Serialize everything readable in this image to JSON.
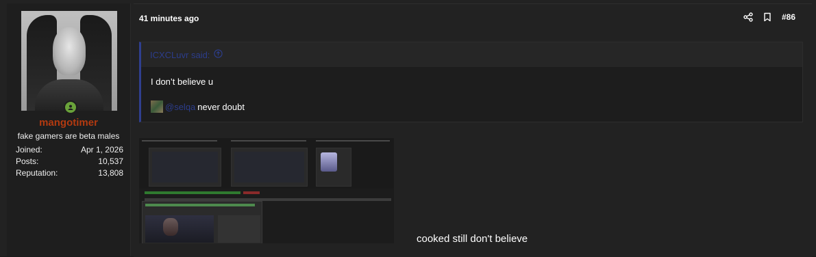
{
  "user": {
    "username": "mangotimer",
    "title": "fake gamers are beta males",
    "stats": [
      {
        "label": "Joined:",
        "value": "Apr 1, 2026"
      },
      {
        "label": "Posts:",
        "value": "10,537"
      },
      {
        "label": "Reputation:",
        "value": "13,808"
      }
    ],
    "status": "online"
  },
  "post": {
    "timestamp": "41 minutes ago",
    "number": "#86",
    "icons": [
      "share-icon",
      "bookmark-icon"
    ],
    "quote": {
      "author": "ICXCLuvr said:",
      "line1": "I don’t believe u",
      "mention": "@selqa",
      "line2_rest": "never doubt"
    },
    "reply_text": "cooked still don't believe"
  },
  "colors": {
    "username": "#b33a10",
    "link": "#2c3d8c",
    "quote_bar": "#2f3f8f",
    "online": "#6aa33a"
  }
}
